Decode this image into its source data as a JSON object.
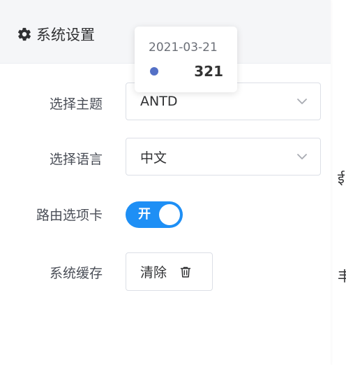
{
  "drawer": {
    "title": "系统设置",
    "theme": {
      "label": "选择主题",
      "value": "ANTD"
    },
    "language": {
      "label": "选择语言",
      "value": "中文"
    },
    "tabs": {
      "label": "路由选项卡",
      "switch_text": "开",
      "enabled": true
    },
    "cache": {
      "label": "系统缓存",
      "button_label": "清除"
    }
  },
  "tooltip": {
    "date": "2021-03-21",
    "value": "321",
    "series_color": "#5470c6"
  },
  "colors": {
    "accent": "#1e8ff5",
    "header_bg": "#f5f6f8"
  }
}
